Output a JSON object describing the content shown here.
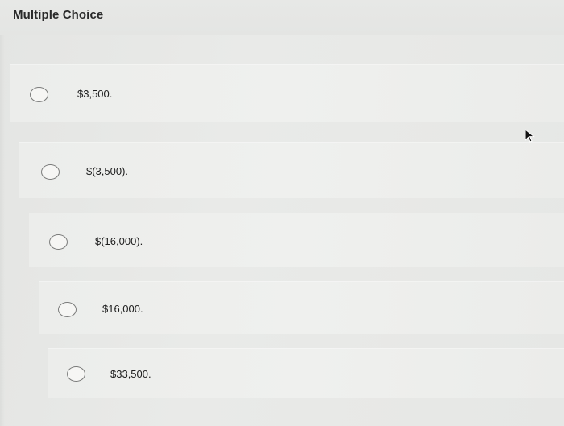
{
  "question": {
    "title": "Multiple Choice"
  },
  "options": [
    {
      "label": "$3,500."
    },
    {
      "label": "$(3,500)."
    },
    {
      "label": "$(16,000)."
    },
    {
      "label": "$16,000."
    },
    {
      "label": "$33,500."
    }
  ],
  "colors": {
    "background": "#e6e7e5",
    "option_band": "#eeefed",
    "radio_border": "#7a7b7a",
    "text": "#1e1e1e"
  },
  "icons": {
    "cursor": "mouse-pointer-icon",
    "radio": "radio-button-icon"
  }
}
